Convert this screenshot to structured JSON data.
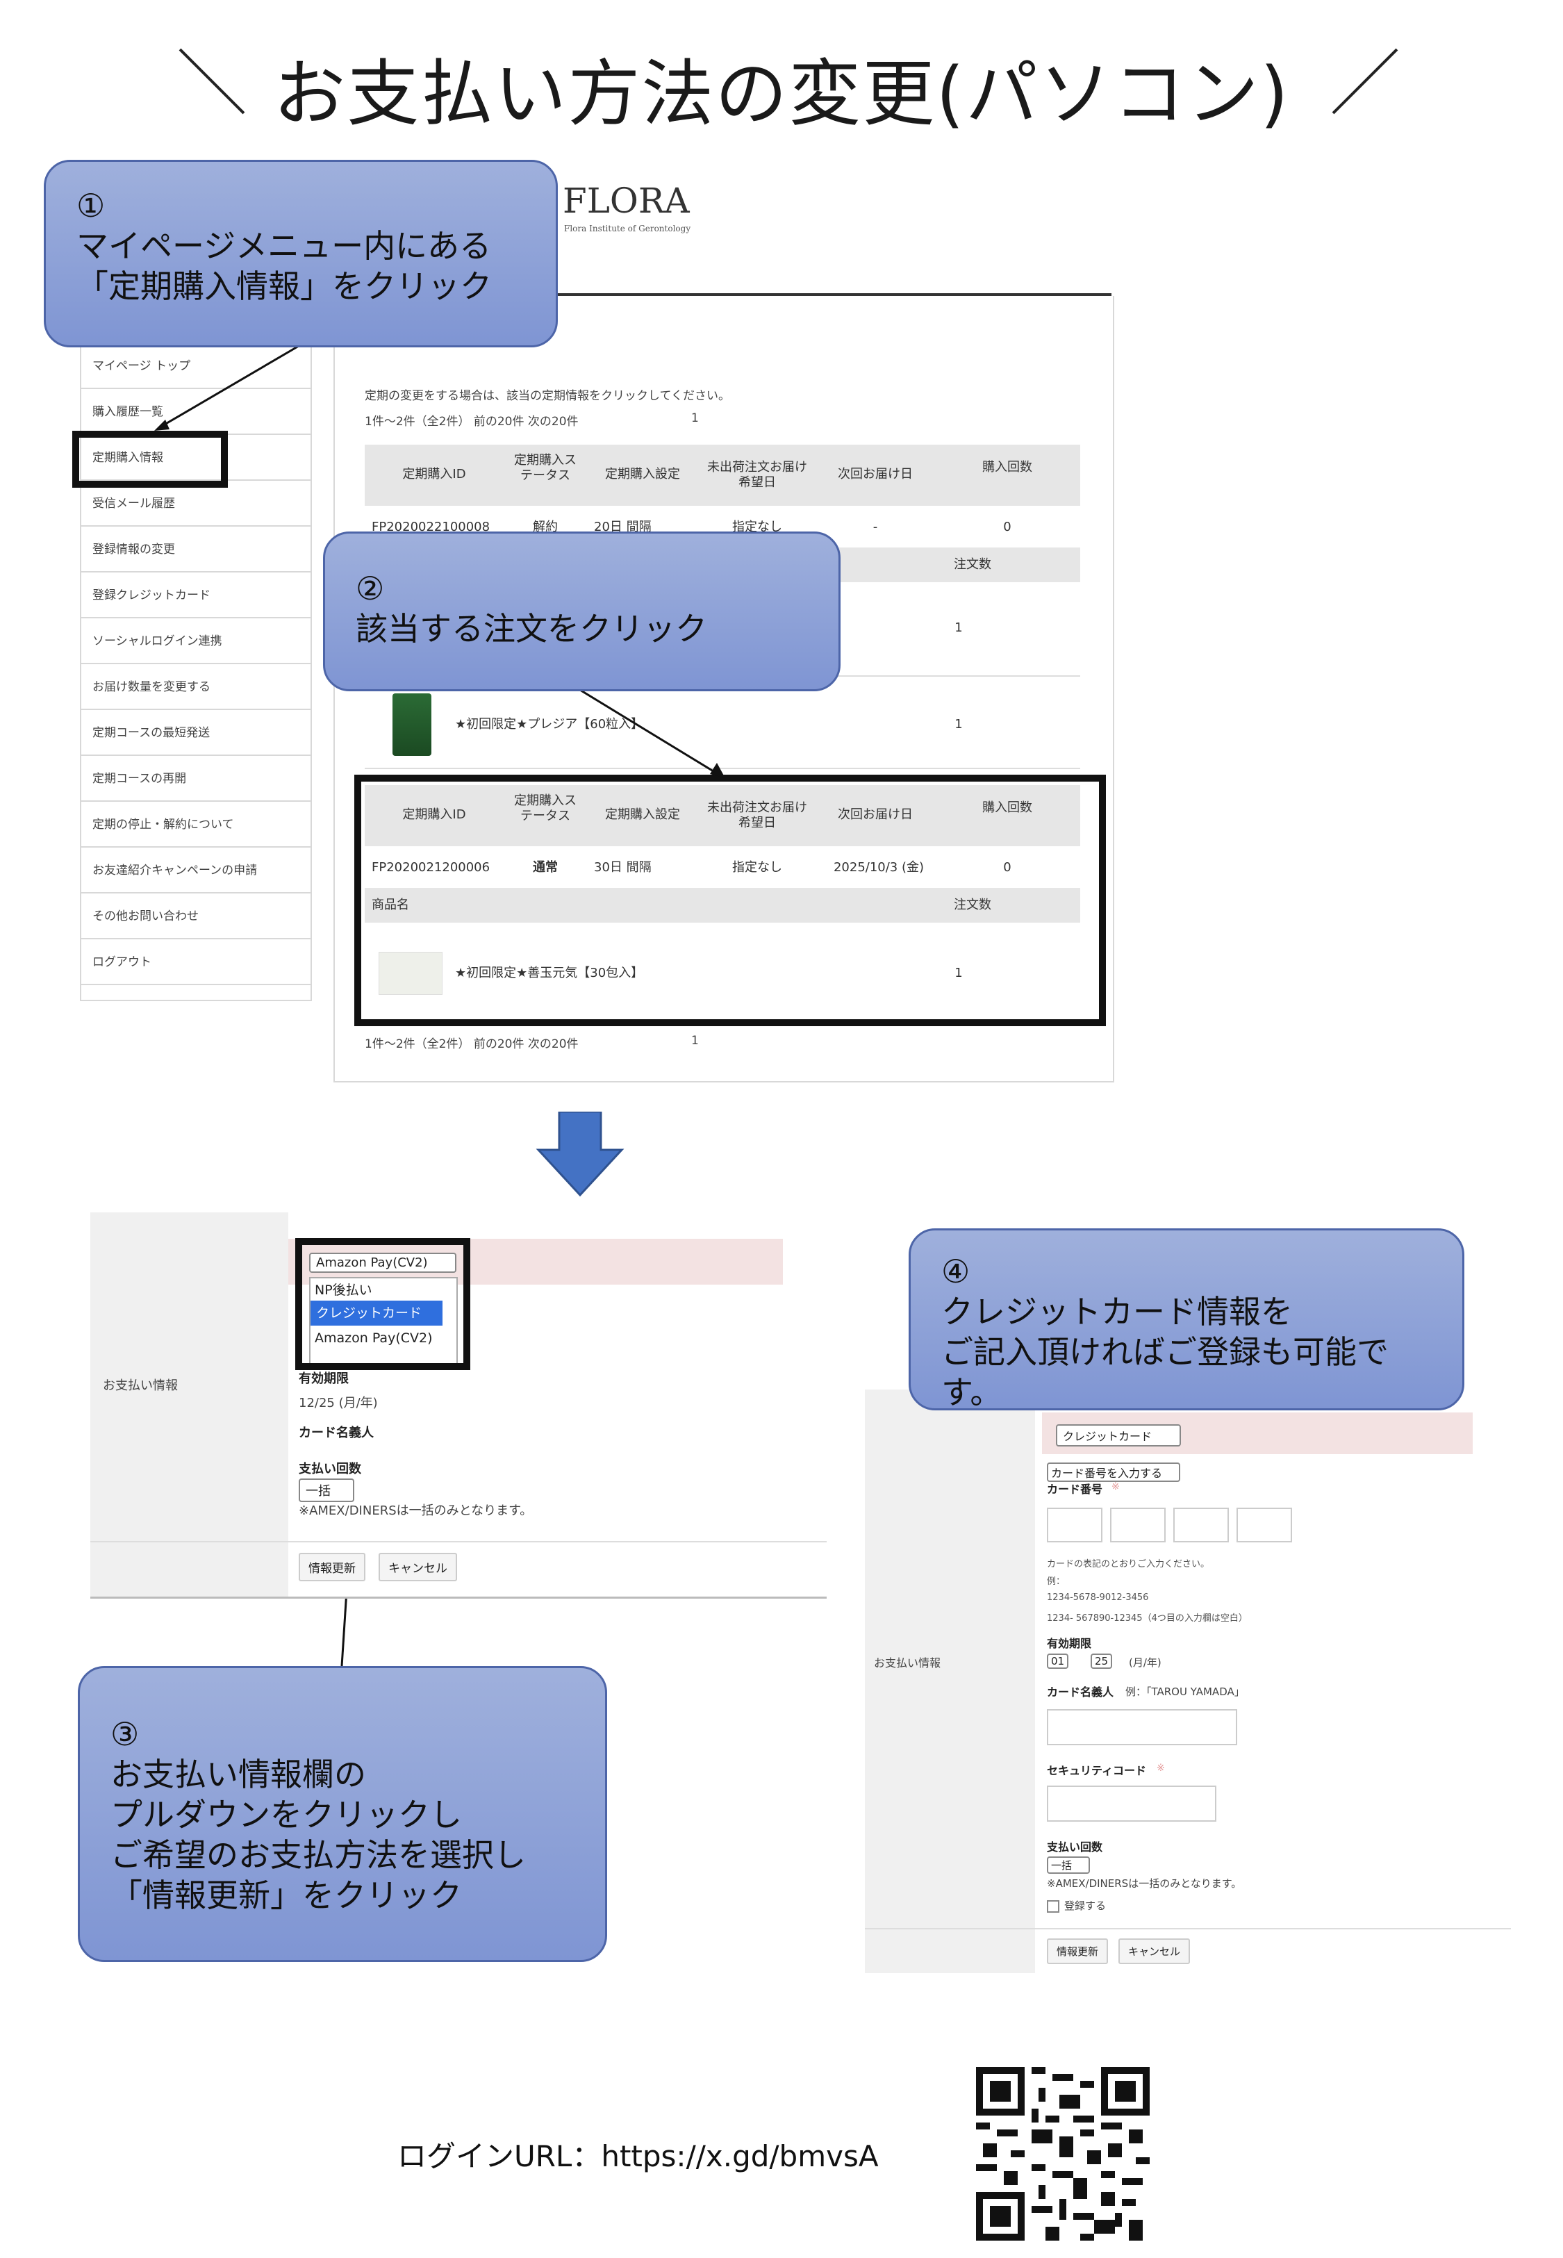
{
  "title": "お支払い方法の変更(パソコン)",
  "flora": {
    "logo": "FLORA",
    "subtitle": "Flora Institute of Gerontology"
  },
  "step1": {
    "num": "①",
    "lines": [
      "マイページメニュー内にある",
      "「定期購入情報」をクリック"
    ]
  },
  "step2": {
    "num": "②",
    "lines": [
      "該当する注文をクリック"
    ]
  },
  "step3": {
    "num": "③",
    "lines": [
      "お支払い情報欄の",
      "プルダウンをクリックし",
      "ご希望のお支払方法を選択し",
      "「情報更新」をクリック"
    ]
  },
  "step4": {
    "num": "④",
    "lines": [
      "クレジットカード情報を",
      "ご記入頂ければご登録も可能です。"
    ]
  },
  "sidebar": [
    "マイページ トップ",
    "購入履歴一覧",
    "定期購入情報",
    "受信メール履歴",
    "登録情報の変更",
    "登録クレジットカード",
    "ソーシャルログイン連携",
    "お届け数量を変更する",
    "定期コースの最短発送",
    "定期コースの再開",
    "定期の停止・解約について",
    "お友達紹介キャンペーンの申請",
    "その他お問い合わせ",
    "ログアウト"
  ],
  "orders": {
    "instruction": "定期の変更をする場合は、該当の定期情報をクリックしてください。",
    "pager": "1件～2件（全2件） 前の20件 次の20件",
    "page_num": "1",
    "headers": [
      "定期購入ID",
      "定期購入ステータス",
      "定期購入設定",
      "未出荷注文お届け希望日",
      "次回お届け日",
      "購入回数"
    ],
    "product_header": "商品名",
    "qty_header": "注文数",
    "row1": {
      "id": "FP2020022100008",
      "status": "解約",
      "setting": "20日 間隔",
      "date": "指定なし",
      "next": "-",
      "count": "0"
    },
    "row1_products": [
      {
        "name": "",
        "qty": "1"
      },
      {
        "name": "★初回限定★プレジア【60粒入】",
        "qty": "1"
      }
    ],
    "row2": {
      "id": "FP2020021200006",
      "status": "通常",
      "setting": "30日 間隔",
      "date": "指定なし",
      "next": "2025/10/3 (金)",
      "count": "0"
    },
    "row2_product": {
      "name": "★初回限定★善玉元気【30包入】",
      "qty": "1"
    }
  },
  "payment_left": {
    "label": "お支払い情報",
    "select": "Amazon Pay(CV2)",
    "options": [
      "NP後払い",
      "クレジットカード",
      "Amazon Pay(CV2)"
    ],
    "expiry_label": "有効期限",
    "expiry_value": "12/25 (月/年)",
    "cardholder_label": "カード名義人",
    "installments_label": "支払い回数",
    "installments_value": "一括",
    "note": "※AMEX/DINERSは一括のみとなります。",
    "update_btn": "情報更新",
    "cancel_btn": "キャンセル"
  },
  "payment_right": {
    "label": "お支払い情報",
    "select": "クレジットカード",
    "card_input_select": "カード番号を入力する",
    "card_number_label": "カード番号",
    "required": "※",
    "hint1": "カードの表記のとおりご入力ください。",
    "hint2": "例：",
    "hint3": "1234-5678-9012-3456",
    "hint4": "1234- 567890-12345（4つ目の入力欄は空白）",
    "expiry_label": "有効期限",
    "month": "01",
    "year": "25",
    "unit": "(月/年)",
    "cardholder_label": "カード名義人",
    "cardholder_example": "例：「TAROU YAMADA」",
    "cvc_label": "セキュリティコード",
    "installments_label": "支払い回数",
    "installments_value": "一括",
    "note": "※AMEX/DINERSは一括のみとなります。",
    "register": "登録する",
    "update_btn": "情報更新",
    "cancel_btn": "キャンセル"
  },
  "login": {
    "label": "ログインURL：https://x.gd/bmvsA"
  },
  "colors": {
    "bubble": "#8c9fd8",
    "arrow": "#4472c4",
    "box": "#111111"
  }
}
